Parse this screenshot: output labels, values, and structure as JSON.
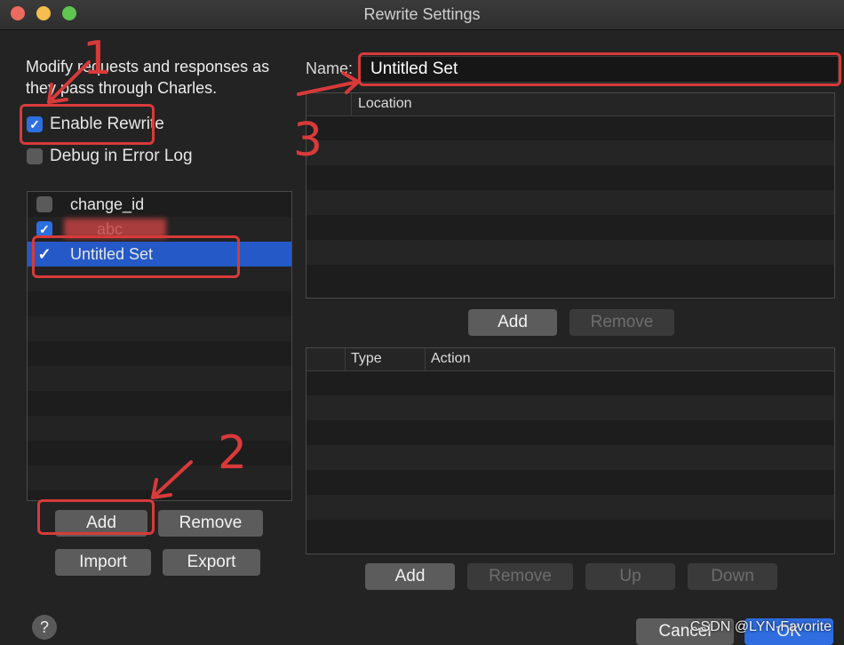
{
  "window": {
    "title": "Rewrite Settings",
    "traffic_lights": [
      "#ed6a5e",
      "#f4bf4f",
      "#61c554"
    ]
  },
  "left": {
    "description": "Modify requests and responses as they pass through Charles.",
    "enable_rewrite": {
      "label": "Enable Rewrite",
      "checked": true
    },
    "debug_log": {
      "label": "Debug in Error Log",
      "checked": false
    },
    "sets": [
      {
        "label": "change_id",
        "checked": false
      },
      {
        "label": "abc",
        "checked": true,
        "partially_obscured": true
      },
      {
        "label": "Untitled Set",
        "checked": true,
        "selected": true
      }
    ],
    "buttons": {
      "add": "Add",
      "remove": "Remove",
      "import": "Import",
      "export": "Export"
    }
  },
  "right": {
    "name_label": "Name:",
    "name_value": "Untitled Set",
    "location_table": {
      "header": "Location",
      "rows": []
    },
    "location_buttons": {
      "add": "Add",
      "remove": "Remove"
    },
    "rules_table": {
      "headers": [
        "Type",
        "Action"
      ],
      "rows": []
    },
    "rule_buttons": {
      "add": "Add",
      "remove": "Remove",
      "up": "Up",
      "down": "Down"
    }
  },
  "footer": {
    "help": "?",
    "cancel": "Cancel",
    "ok": "OK"
  },
  "annotations": {
    "n1": "1",
    "n2": "2",
    "n3": "3",
    "color": "#d83a3a"
  },
  "watermark": "CSDN @LYN-Favorite"
}
